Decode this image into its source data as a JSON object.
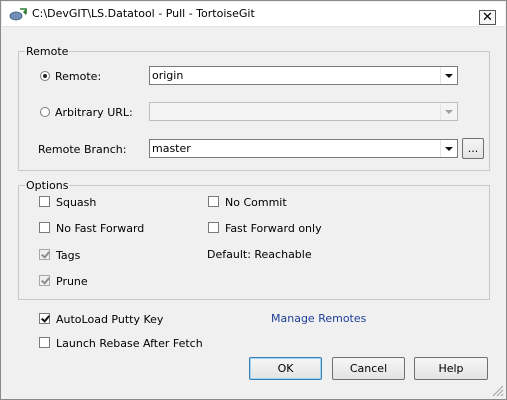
{
  "window": {
    "title": "C:\\DevGIT\\LS.Datatool - Pull - TortoiseGit",
    "close_glyph": "✕"
  },
  "remote_group": {
    "legend": "Remote",
    "remote_radio_label": "Remote:",
    "remote_value": "origin",
    "arbitrary_radio_label": "Arbitrary URL:",
    "arbitrary_value": "",
    "branch_label": "Remote Branch:",
    "branch_value": "master",
    "browse_label": "..."
  },
  "options_group": {
    "legend": "Options",
    "squash": "Squash",
    "no_commit": "No Commit",
    "no_fast_forward": "No Fast Forward",
    "fast_forward_only": "Fast Forward only",
    "tags": "Tags",
    "default_reachable": "Default: Reachable",
    "prune": "Prune"
  },
  "bottom": {
    "autoload_putty": "AutoLoad Putty Key",
    "launch_rebase": "Launch Rebase After Fetch",
    "manage_remotes": "Manage Remotes"
  },
  "buttons": {
    "ok": "OK",
    "cancel": "Cancel",
    "help": "Help"
  },
  "state": {
    "remote_radio_selected": true,
    "arbitrary_radio_selected": false,
    "squash_checked": false,
    "no_commit_checked": false,
    "no_fast_forward_checked": false,
    "fast_forward_only_checked": false,
    "tags_checked": true,
    "prune_checked": true,
    "autoload_checked": true,
    "launch_rebase_checked": false
  },
  "icons": {
    "app": "tortoisegit-pull-icon",
    "close": "close-icon",
    "grip": "resize-grip-icon"
  },
  "colors": {
    "link": "#1d3f9a",
    "default_button_border": "#3c7fb1"
  }
}
